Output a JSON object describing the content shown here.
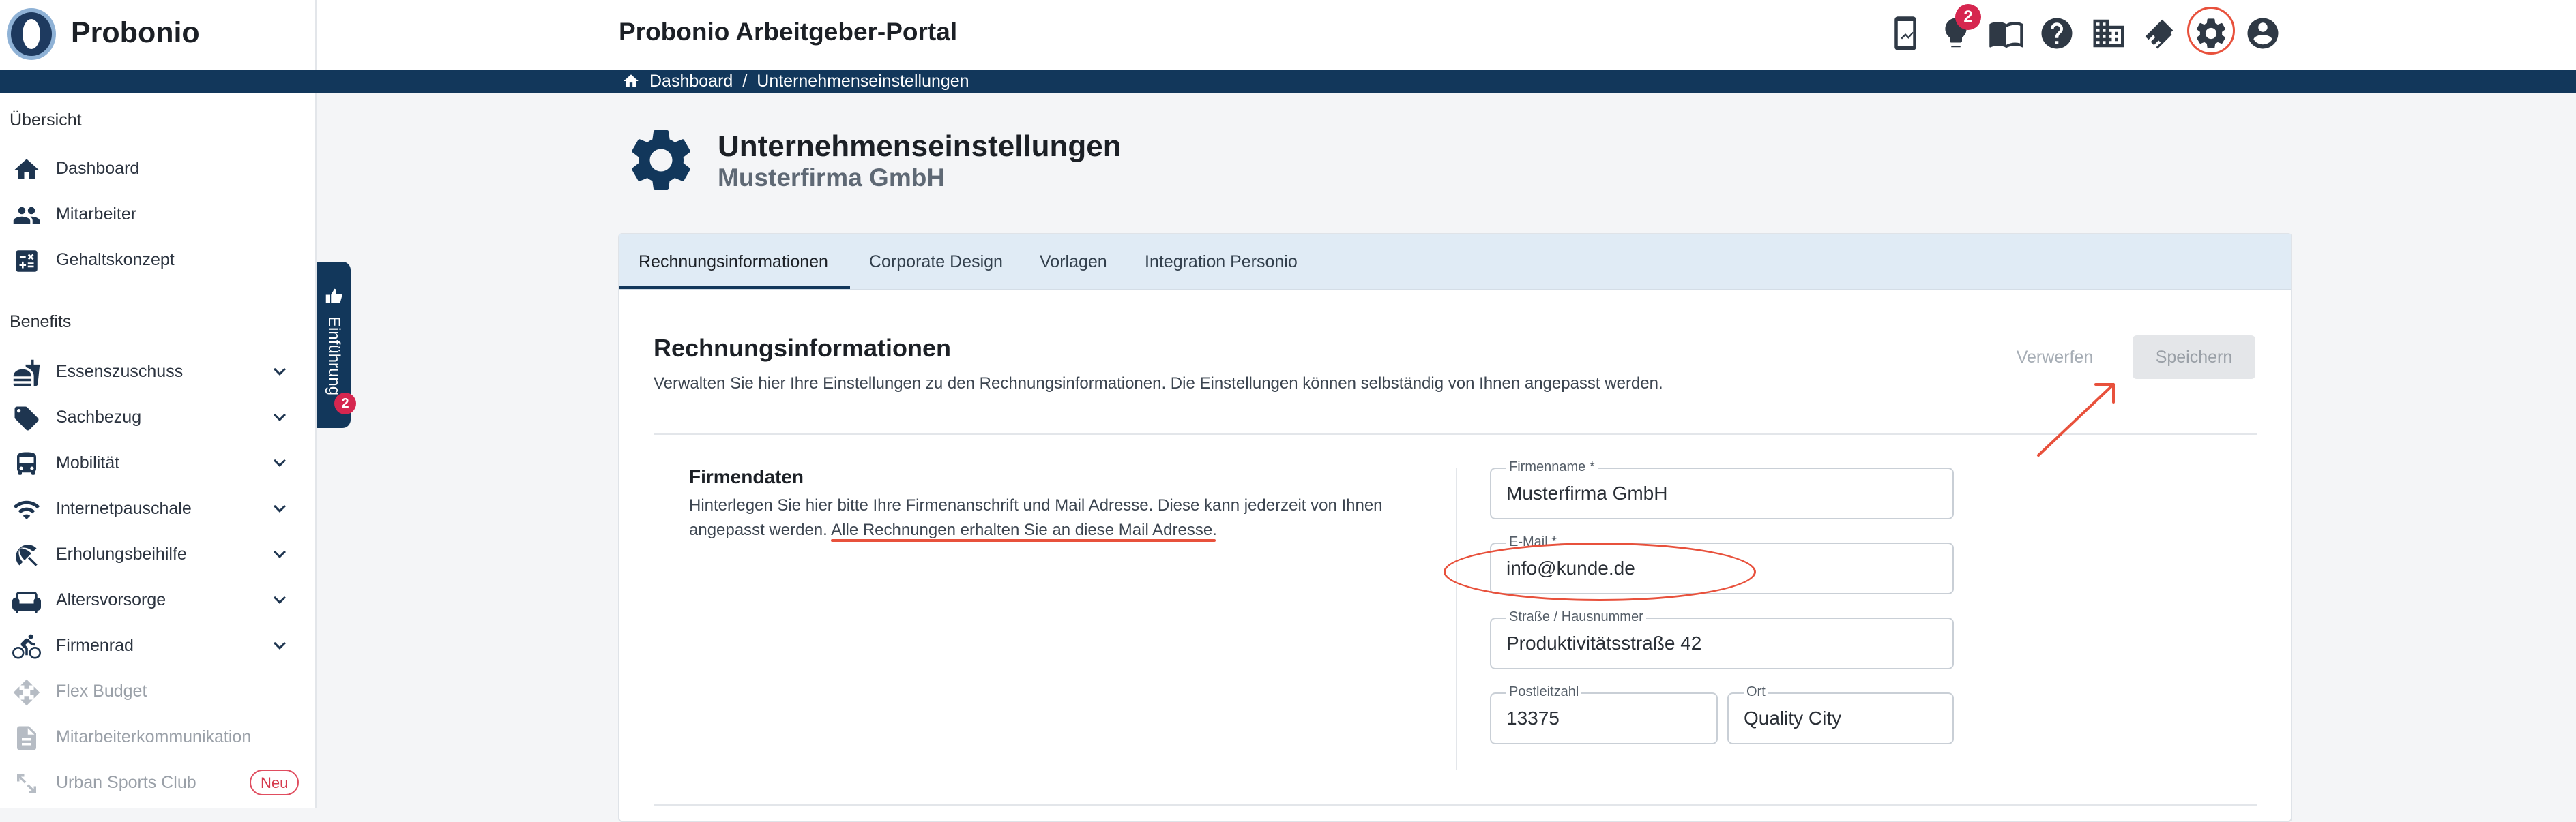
{
  "app": {
    "brand": "Probonio",
    "portal_title": "Probonio Arbeitgeber-Portal",
    "notifications_count": "2",
    "accent_color": "#12375b",
    "danger_color": "#d6264f"
  },
  "header_icons": [
    "phone-chart-icon",
    "lightbulb-icon",
    "book-icon",
    "help-icon",
    "company-icon",
    "handshake-icon",
    "gear-icon",
    "account-icon"
  ],
  "breadcrumb": {
    "home": "Dashboard",
    "separator": "/",
    "current": "Unternehmenseinstellungen"
  },
  "sidebar": {
    "overview_label": "Übersicht",
    "overview": [
      {
        "label": "Dashboard",
        "icon": "home-icon"
      },
      {
        "label": "Mitarbeiter",
        "icon": "people-icon"
      },
      {
        "label": "Gehaltskonzept",
        "icon": "calculator-icon"
      }
    ],
    "benefits_label": "Benefits",
    "benefits": [
      {
        "label": "Essenszuschuss",
        "icon": "food-icon"
      },
      {
        "label": "Sachbezug",
        "icon": "tag-icon"
      },
      {
        "label": "Mobilität",
        "icon": "bus-icon"
      },
      {
        "label": "Internetpauschale",
        "icon": "wifi-icon"
      },
      {
        "label": "Erholungsbeihilfe",
        "icon": "palm-icon"
      },
      {
        "label": "Altersvorsorge",
        "icon": "sofa-icon"
      },
      {
        "label": "Firmenrad",
        "icon": "bike-icon"
      },
      {
        "label": "Flex Budget",
        "icon": "move-icon"
      },
      {
        "label": "Mitarbeiterkommunikation",
        "icon": "document-icon"
      },
      {
        "label": "Urban Sports Club",
        "icon": "arrows-icon",
        "badge": "Neu"
      }
    ]
  },
  "intro_tab": {
    "label": "Einführung",
    "badge": "2"
  },
  "page": {
    "title": "Unternehmenseinstellungen",
    "subtitle": "Musterfirma GmbH"
  },
  "tabs": [
    {
      "label": "Rechnungsinformationen",
      "active": true
    },
    {
      "label": "Corporate Design",
      "active": false
    },
    {
      "label": "Vorlagen",
      "active": false
    },
    {
      "label": "Integration Personio",
      "active": false
    }
  ],
  "section": {
    "title": "Rechnungsinformationen",
    "description": "Verwalten Sie hier Ihre Einstellungen zu den Rechnungsinformationen. Die Einstellungen können selbständig von Ihnen angepasst werden.",
    "discard_label": "Verwerfen",
    "save_label": "Speichern"
  },
  "firmendaten": {
    "title": "Firmendaten",
    "description": "Hinterlegen Sie hier bitte Ihre Firmenanschrift und Mail Adresse. Diese kann jederzeit von Ihnen angepasst werden. Alle Rechnungen erhalten Sie an diese Mail Adresse."
  },
  "form": {
    "company_label": "Firmenname *",
    "company_value": "Musterfirma GmbH",
    "email_label": "E-Mail *",
    "email_value": "info@kunde.de",
    "street_label": "Straße / Hausnummer",
    "street_value": "Produktivitätsstraße 42",
    "zip_label": "Postleitzahl",
    "zip_value": "13375",
    "city_label": "Ort",
    "city_value": "Quality City"
  }
}
